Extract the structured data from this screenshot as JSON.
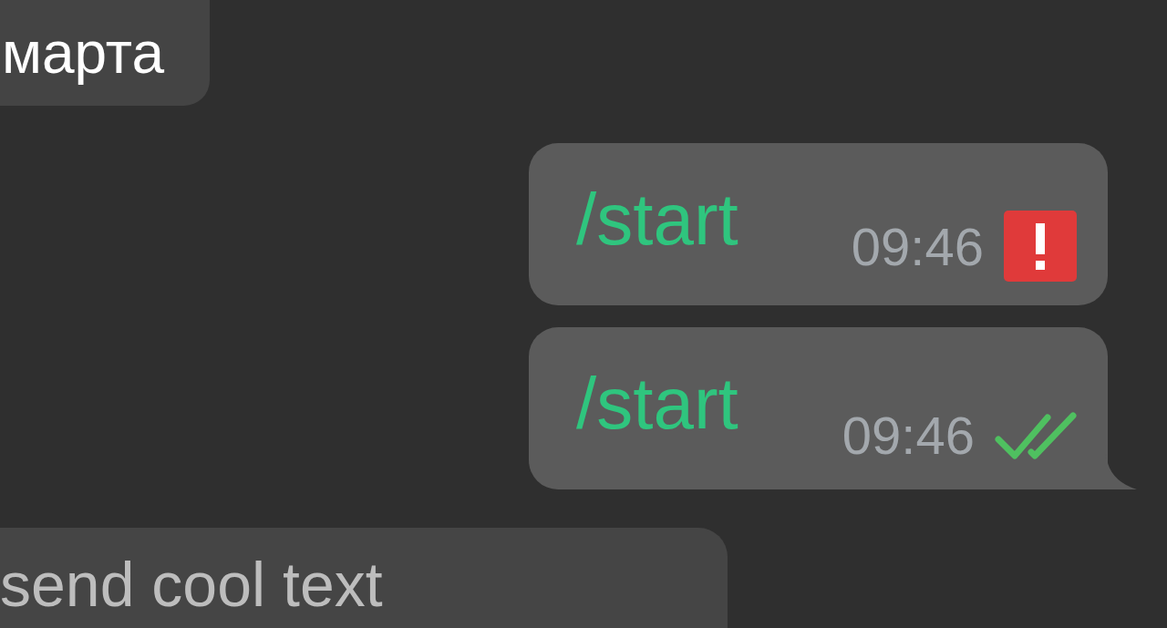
{
  "date_pill": {
    "text": "марта"
  },
  "messages": [
    {
      "kind": "outgoing",
      "text": "/start",
      "time": "09:46",
      "failed": true,
      "tail": false
    },
    {
      "kind": "outgoing",
      "text": "/start",
      "time": "09:46",
      "failed": false,
      "read": true,
      "tail": true
    },
    {
      "kind": "incoming",
      "text": "send cool text"
    }
  ]
}
